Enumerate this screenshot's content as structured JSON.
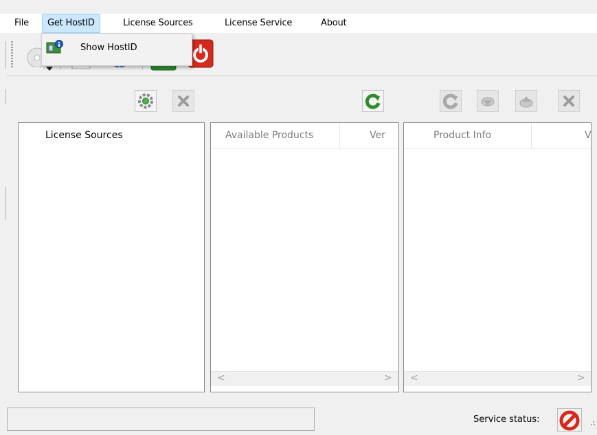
{
  "menubar": {
    "items": [
      {
        "label": "File"
      },
      {
        "label": "Get HostID"
      },
      {
        "label": "License Sources"
      },
      {
        "label": "License Service"
      },
      {
        "label": "About"
      }
    ]
  },
  "dropdown": {
    "items": [
      {
        "label": "Show HostID",
        "icon": "hostid-icon"
      }
    ]
  },
  "panels": {
    "sources": {
      "header": "License Sources"
    },
    "products": {
      "columns": [
        "Available Products",
        "Ver"
      ]
    },
    "info": {
      "columns": [
        "Product Info",
        "V"
      ]
    }
  },
  "scroll": {
    "left": "<",
    "right": ">"
  },
  "status": {
    "label": "Service status:",
    "state_icon": "stopped-icon"
  },
  "colors": {
    "accent_green": "#2e8b2e",
    "stop_red": "#d42a1d",
    "menu_highlight": "#cce8ff"
  }
}
